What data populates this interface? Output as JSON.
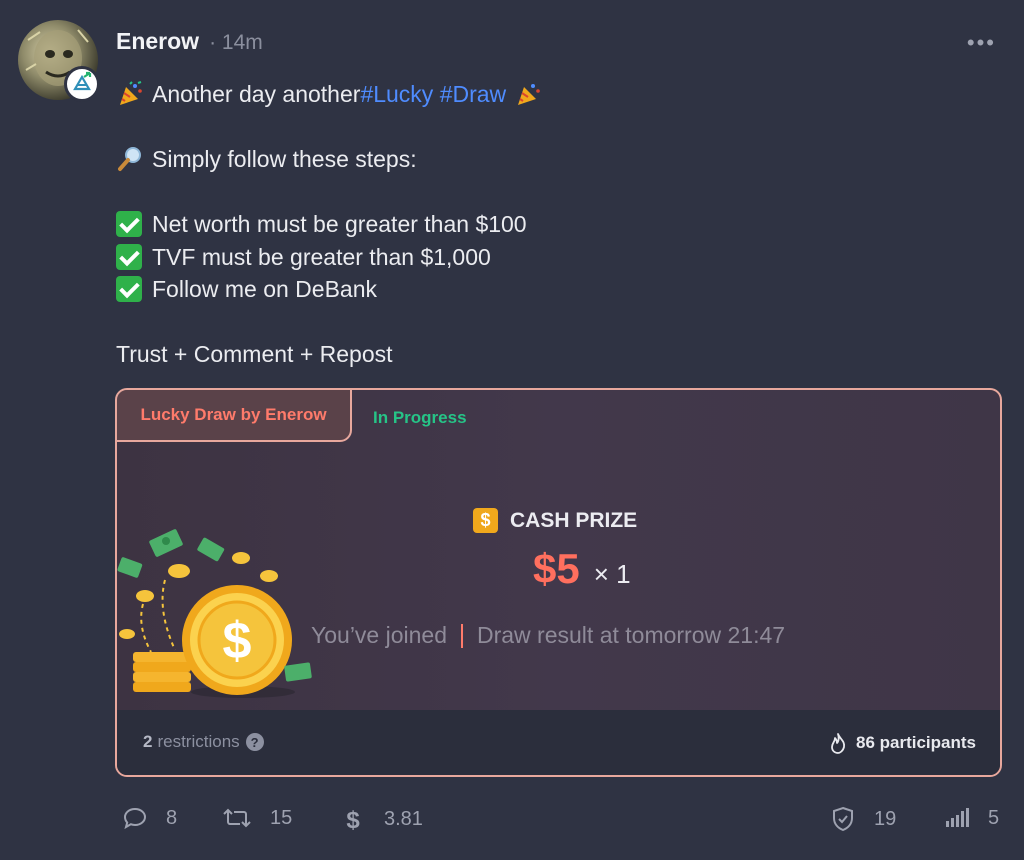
{
  "author": {
    "name": "Enerow",
    "time": "· 14m"
  },
  "post": {
    "intro_prefix": "Another day another ",
    "hashtag1": "#Lucky",
    "hashtag2": "#Draw",
    "steps_intro": "Simply follow these steps:",
    "steps": [
      "Net worth must be greater than $100",
      "TVF must be greater than $1,000",
      "Follow me on DeBank"
    ],
    "closing": "Trust + Comment + Repost"
  },
  "card": {
    "tab_label": "Lucky Draw by Enerow",
    "status": "In Progress",
    "status_color": "#26c487",
    "accent_color": "#ff6f5e",
    "prize_icon": "$",
    "prize_title": "CASH PRIZE",
    "prize_amount": "$5",
    "prize_multiplier": "× 1",
    "joined_text": "You’ve joined",
    "draw_text": "Draw result at tomorrow 21:47",
    "restrictions_count": "2",
    "restrictions_label": "restrictions",
    "restrictions_help": "?",
    "participants": "86 participants"
  },
  "actions": {
    "comments": "8",
    "reposts": "15",
    "tips": "3.81",
    "trust": "19",
    "views": "5"
  },
  "icons": [
    "more-icon",
    "party-popper-icon",
    "magnifier-icon",
    "check-icon",
    "dollar-icon",
    "fire-icon",
    "comment-icon",
    "repost-icon",
    "tip-icon",
    "shield-icon",
    "signal-icon"
  ]
}
